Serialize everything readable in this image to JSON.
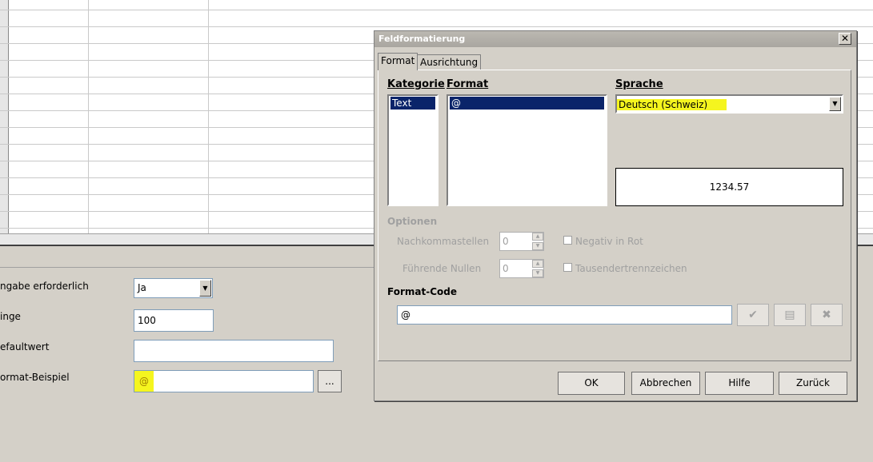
{
  "properties": {
    "input_required": {
      "label": "ngabe erforderlich",
      "value": "Ja"
    },
    "length": {
      "label": "inge",
      "value": "100"
    },
    "default_value": {
      "label": "efaultwert",
      "value": ""
    },
    "format_example": {
      "label": "ormat-Beispiel",
      "value": "@",
      "button": "..."
    }
  },
  "dialog": {
    "title": "Feldformatierung",
    "close_glyph": "✕",
    "tabs": [
      "Format",
      "Ausrichtung"
    ],
    "category": {
      "header": "Kategorie",
      "items": [
        "Text"
      ]
    },
    "format": {
      "header": "Format",
      "items": [
        "@"
      ]
    },
    "language": {
      "header": "Sprache",
      "value": "Deutsch (Schweiz)"
    },
    "preview": "1234.57",
    "options": {
      "header": "Optionen",
      "decimal_places": {
        "label": "Nachkommastellen",
        "value": "0"
      },
      "leading_zeros": {
        "label": "Führende Nullen",
        "value": "0"
      },
      "negative_red": "Negativ in Rot",
      "thousands_sep": "Tausendertrennzeichen"
    },
    "format_code": {
      "header": "Format-Code",
      "value": "@"
    },
    "buttons": {
      "ok": "OK",
      "cancel": "Abbrechen",
      "help": "Hilfe",
      "reset": "Zurück"
    }
  },
  "colors": {
    "highlight": "#f5f51f",
    "selection": "#0a246a"
  },
  "icons": {
    "apply": "check-icon",
    "comment": "comment-icon",
    "delete": "delete-icon"
  }
}
